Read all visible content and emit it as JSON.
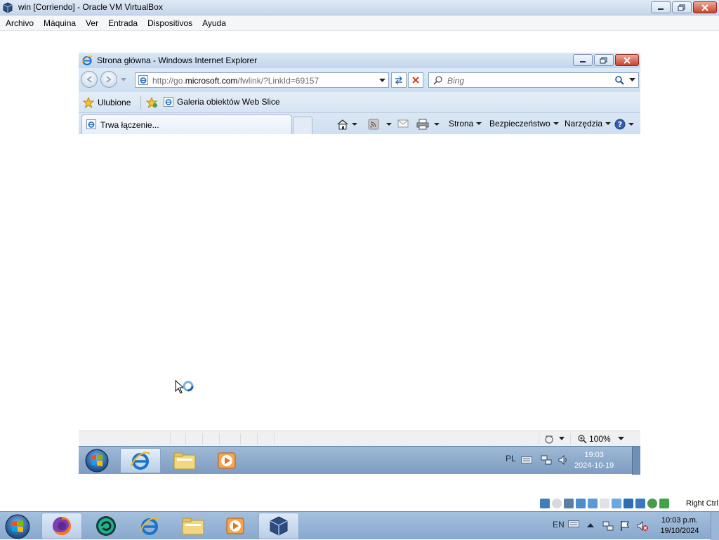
{
  "vbox": {
    "title": "win [Corriendo] - Oracle VM VirtualBox",
    "menu": [
      "Archivo",
      "Máquina",
      "Ver",
      "Entrada",
      "Dispositivos",
      "Ayuda"
    ],
    "host_key": "Right Ctrl"
  },
  "ie": {
    "title": "Strona główna - Windows Internet Explorer",
    "address": {
      "url_prefix": "http://go.",
      "url_domain": "microsoft.com",
      "url_suffix": "/fwlink/?LinkId=69157"
    },
    "search": {
      "placeholder": "Bing"
    },
    "favorites": {
      "favorites_label": "Ulubione",
      "webslice_label": "Galeria obiektów Web Slice"
    },
    "tab": {
      "label": "Trwa łączenie..."
    },
    "commands": {
      "page": "Strona",
      "safety": "Bezpieczeństwo",
      "tools": "Narzędzia"
    },
    "status": {
      "zoom": "100%"
    }
  },
  "guest_taskbar": {
    "lang": "PL",
    "time": "19:03",
    "date": "2024-10-19",
    "buttons": [
      "start-orb",
      "internet-explorer",
      "windows-explorer",
      "media-player"
    ]
  },
  "host_taskbar": {
    "lang": "EN",
    "time": "10:03 p.m.",
    "date": "19/10/2024",
    "buttons": [
      "firefox",
      "app-green-circle",
      "internet-explorer",
      "windows-explorer",
      "media-player",
      "virtualbox"
    ]
  },
  "colors": {
    "titlebar": "#c6d7ec",
    "taskbar": "#88a8cc",
    "close": "#c9452d"
  }
}
